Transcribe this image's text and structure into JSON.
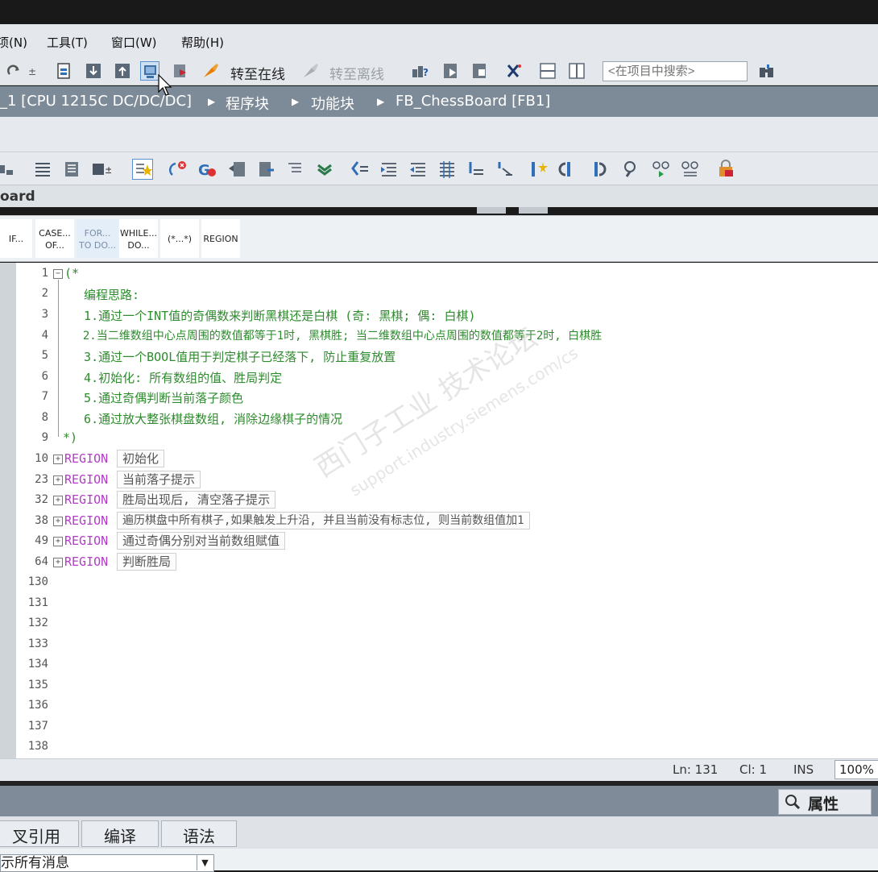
{
  "menu": {
    "items": [
      "项(N)",
      "工具(T)",
      "窗口(W)",
      "帮助(H)"
    ]
  },
  "toolbar": {
    "go_online": "转至在线",
    "go_offline": "转至离线",
    "search_placeholder": "<在项目中搜索>"
  },
  "breadcrumb": {
    "device": "_1 [CPU 1215C DC/DC/DC]",
    "program_blocks": "程序块",
    "function_blocks": "功能块",
    "block": "FB_ChessBoard [FB1]"
  },
  "block_title": "oard",
  "instructions": {
    "if": "IF...",
    "case_1": "CASE...",
    "case_2": "OF...",
    "for_1": "FOR...",
    "for_2": "TO DO...",
    "while_1": "WHILE...",
    "while_2": "DO...",
    "comment": "(*...*)",
    "region": "REGION"
  },
  "code": {
    "lines": [
      {
        "num": "1",
        "text": "(*"
      },
      {
        "num": "2",
        "text": "  编程思路:"
      },
      {
        "num": "3",
        "text": "  1.通过一个INT值的奇偶数来判断黑棋还是白棋 (奇: 黑棋; 偶: 白棋)"
      },
      {
        "num": "4",
        "text": "  2.当二维数组中心点周围的数值都等于1时, 黑棋胜; 当二维数组中心点周围的数值都等于2时, 白棋胜"
      },
      {
        "num": "5",
        "text": "  3.通过一个BOOL值用于判定棋子已经落下, 防止重复放置"
      },
      {
        "num": "6",
        "text": "  4.初始化: 所有数组的值、胜局判定"
      },
      {
        "num": "7",
        "text": "  5.通过奇偶判断当前落子颜色"
      },
      {
        "num": "8",
        "text": "  6.通过放大整张棋盘数组, 消除边缘棋子的情况"
      },
      {
        "num": "9",
        "text": "*)"
      }
    ],
    "region_keyword": "REGION",
    "regions": [
      {
        "num": "10",
        "name": "初始化"
      },
      {
        "num": "23",
        "name": "当前落子提示"
      },
      {
        "num": "32",
        "name": "胜局出现后, 清空落子提示"
      },
      {
        "num": "38",
        "name": "遍历棋盘中所有棋子,如果触发上升沿, 并且当前没有标志位, 则当前数组值加1"
      },
      {
        "num": "49",
        "name": "通过奇偶分别对当前数组赋值"
      },
      {
        "num": "64",
        "name": "判断胜局"
      }
    ],
    "empty_lines": [
      "130",
      "131",
      "132",
      "133",
      "134",
      "135",
      "136",
      "137",
      "138"
    ]
  },
  "status": {
    "ln": "Ln: 131",
    "cl": "Cl: 1",
    "mode": "INS",
    "zoom": "100%"
  },
  "bottom": {
    "properties": "属性",
    "tabs": [
      "叉引用",
      "编译",
      "语法"
    ],
    "message_filter": "示所有消息"
  },
  "watermark": {
    "line1": "西门子工业 技术论坛",
    "line2": "support.industry.siemens.com/cs"
  },
  "colors": {
    "breadcrumb_bg": "#7d8a97",
    "comment_green": "#2e8b2e",
    "keyword_purple": "#b23cc6"
  }
}
